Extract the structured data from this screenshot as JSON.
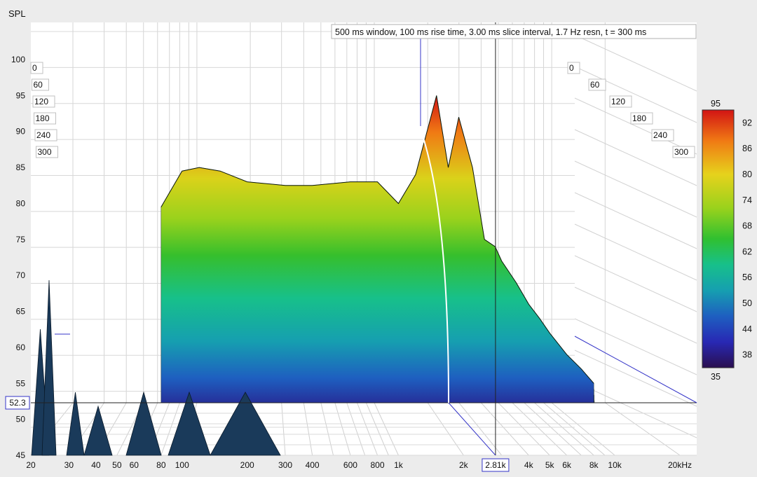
{
  "chart_data": {
    "type": "area",
    "ylabel": "SPL",
    "xunit": "kHz",
    "annotation": "500 ms window, 100 ms rise time, 3.00 ms slice interval, 1.7 Hz resn, t = 300 ms",
    "x_scale": "log",
    "xlim": [
      20,
      20000
    ],
    "ylim": [
      45,
      100
    ],
    "x_ticks": [
      "20",
      "30",
      "40",
      "50",
      "60",
      "80",
      "100",
      "200",
      "300",
      "400",
      "600",
      "800",
      "1k",
      "2k",
      "2.81k",
      "4k",
      "5k",
      "6k",
      "8k",
      "10k",
      "20kHz"
    ],
    "y_ticks": [
      "45",
      "50",
      "55",
      "60",
      "65",
      "70",
      "75",
      "80",
      "85",
      "90",
      "95",
      "100"
    ],
    "time_ticks": [
      "0",
      "60",
      "120",
      "180",
      "240",
      "300"
    ],
    "cursor": {
      "x": 2810,
      "x_label": "2.81k",
      "y": 52.3,
      "y_label": "52.3"
    },
    "colorbar": {
      "min_label": "35",
      "max_label": "95",
      "ticks": [
        "92",
        "86",
        "80",
        "74",
        "68",
        "62",
        "56",
        "50",
        "44",
        "38"
      ]
    },
    "series": [
      {
        "slice": "t = 0 ms",
        "x": [
          80,
          100,
          120,
          150,
          200,
          300,
          400,
          600,
          800,
          1000,
          1200,
          1500,
          1700,
          1900,
          2200,
          2500,
          2800,
          3000,
          3500,
          4000,
          4500,
          5000,
          6000,
          7000,
          8000
        ],
        "y": [
          79.5,
          84.5,
          85,
          84.5,
          83,
          82.5,
          82.5,
          83,
          83,
          80,
          84,
          95,
          85,
          92,
          85,
          75,
          74,
          72,
          69,
          66,
          64,
          62,
          59,
          57,
          55
        ]
      }
    ],
    "grid": true,
    "legend": "right"
  },
  "colors": {
    "background": "#ececec",
    "plot_background": "#ffffff",
    "grid": "#c8c8c8",
    "cursor": "#3535c8",
    "colormap": [
      "#2a0f4f",
      "#2828b4",
      "#1e5fc0",
      "#169fb0",
      "#17c08a",
      "#30c030",
      "#9ad21c",
      "#e6d21c",
      "#f07a14",
      "#d21414"
    ]
  }
}
